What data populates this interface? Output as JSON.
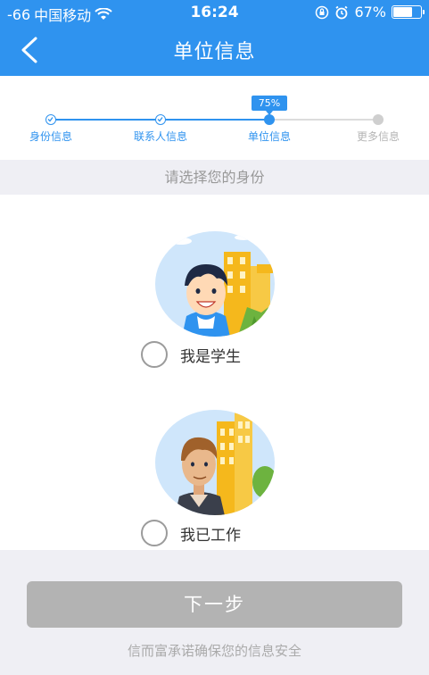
{
  "status_bar": {
    "signal": "-66",
    "carrier": "中国移动",
    "time": "16:24",
    "battery": "67%",
    "battery_level": 0.67
  },
  "nav": {
    "title": "单位信息",
    "back_icon": "chevron-left-icon"
  },
  "progress": {
    "percent_label": "75%",
    "percent_value": 75,
    "steps": [
      {
        "label": "身份信息",
        "state": "done"
      },
      {
        "label": "联系人信息",
        "state": "done"
      },
      {
        "label": "单位信息",
        "state": "current"
      },
      {
        "label": "更多信息",
        "state": "pending"
      }
    ],
    "accent_color": "#2f93ef"
  },
  "prompt": "请选择您的身份",
  "options": [
    {
      "label": "我是学生",
      "selected": false,
      "illustration": "student-avatar"
    },
    {
      "label": "我已工作",
      "selected": false,
      "illustration": "worker-avatar"
    }
  ],
  "next_button": "下一步",
  "promise": "信而富承诺确保您的信息安全"
}
